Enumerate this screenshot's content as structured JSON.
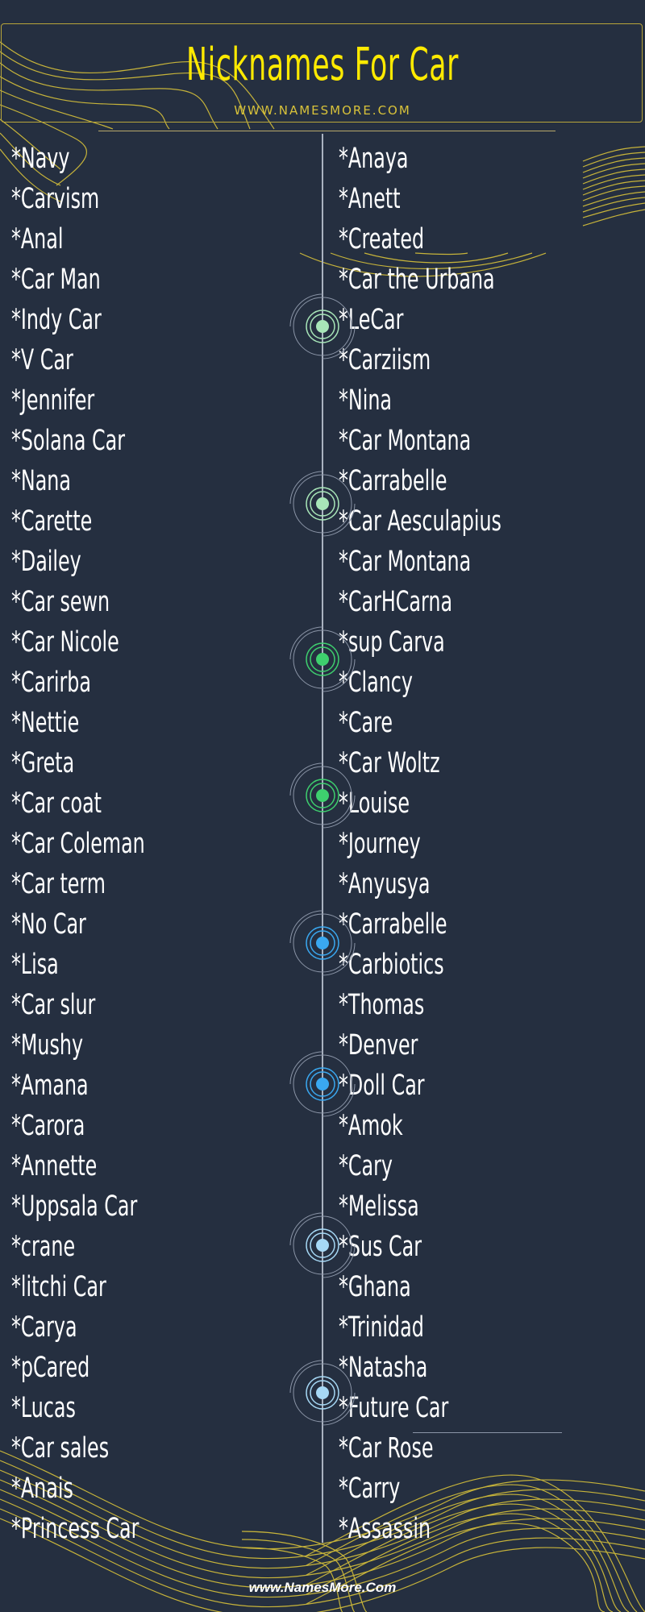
{
  "header": {
    "title": "Nicknames For Car",
    "subtitle": "WWW.NAMESMORE.COM"
  },
  "colors": {
    "background": "#252f40",
    "title": "#ffea00",
    "accent_lines": "#d8c23a",
    "text": "#ffffff",
    "target_green_light": "#a8e6b8",
    "target_green": "#3ecf6e",
    "target_blue": "#3aa8f0",
    "target_blue_light": "#a6d8f5"
  },
  "left_column": [
    "*Navy",
    "*Carvism",
    "*Anal",
    "*Car Man",
    "*Indy Car",
    "*V Car",
    "*Jennifer",
    "*Solana Car",
    "*Nana",
    "*Carette",
    "*Dailey",
    "*Car sewn",
    "*Car Nicole",
    "*Carirba",
    "*Nettie",
    "*Greta",
    "*Car coat",
    "*Car Coleman",
    "*Car term",
    "*No Car",
    "*Lisa",
    "*Car slur",
    "*Mushy",
    "*Amana",
    "*Carora",
    "*Annette",
    "*Uppsala Car",
    "*crane",
    "*litchi Car",
    "*Carya",
    "*pCared",
    "*Lucas",
    "*Car sales",
    "*Anais",
    "*Princess Car"
  ],
  "right_column": [
    "*Anaya",
    "*Anett",
    "*Created",
    "*Car the Urbana",
    "*LeCar",
    "*Carziism",
    "*Nina",
    "*Car Montana",
    "*Carrabelle",
    "*Car Aesculapius",
    "*Car Montana",
    "*CarHCarna",
    "*sup Carva",
    "*Clancy",
    "*Care",
    "*Car Woltz",
    "*Louise",
    "*Journey",
    "*Anyusya",
    "*Carrabelle",
    "*Carbiotics",
    "*Thomas",
    "*Denver",
    "*Doll Car",
    "*Amok",
    "*Cary",
    "*Melissa",
    "*Sus Car",
    "*Ghana",
    "*Trinidad",
    "*Natasha",
    "*Future Car",
    "*Car Rose",
    "*Carry",
    "*Assassin"
  ],
  "timeline_markers": [
    {
      "icon": "target-icon",
      "color": "#a8e6b8"
    },
    {
      "icon": "target-icon",
      "color": "#a8e6b8"
    },
    {
      "icon": "target-icon",
      "color": "#3ecf6e"
    },
    {
      "icon": "target-icon",
      "color": "#3ecf6e"
    },
    {
      "icon": "target-icon",
      "color": "#3aa8f0"
    },
    {
      "icon": "target-icon",
      "color": "#3aa8f0"
    },
    {
      "icon": "target-icon",
      "color": "#a6d8f5"
    },
    {
      "icon": "target-icon",
      "color": "#a6d8f5"
    }
  ],
  "footer": {
    "text": "www.NamesMore.Com"
  }
}
